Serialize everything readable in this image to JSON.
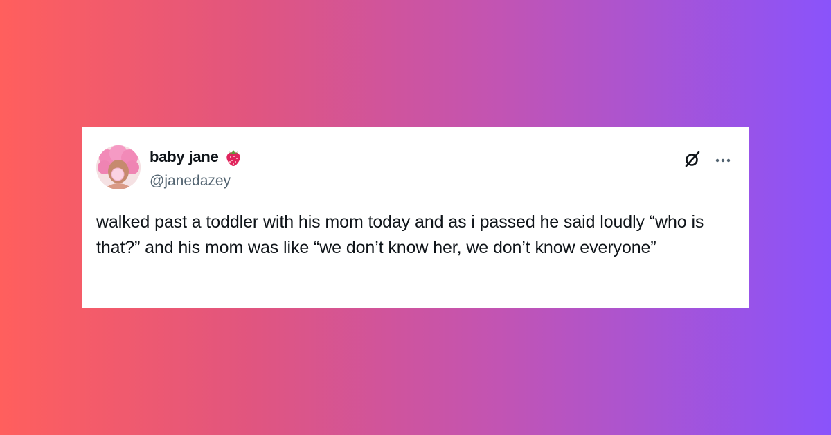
{
  "tweet": {
    "author": {
      "display_name": "baby jane",
      "handle": "@janedazey",
      "name_emoji": "strawberry-icon",
      "avatar": "avatar"
    },
    "text": "walked past a toddler with his mom today and as i passed he said loudly “who is that?” and his mom was like “we don’t know her, we don’t know everyone”",
    "actions": {
      "grok_icon": "grok-icon",
      "more_icon": "more-icon"
    }
  },
  "colors": {
    "gradient_start": "#ff5f5d",
    "gradient_end": "#8a53fb",
    "card_background": "#ffffff",
    "primary_text": "#0f1419",
    "secondary_text": "#536471",
    "strawberry": "#e0245e"
  }
}
